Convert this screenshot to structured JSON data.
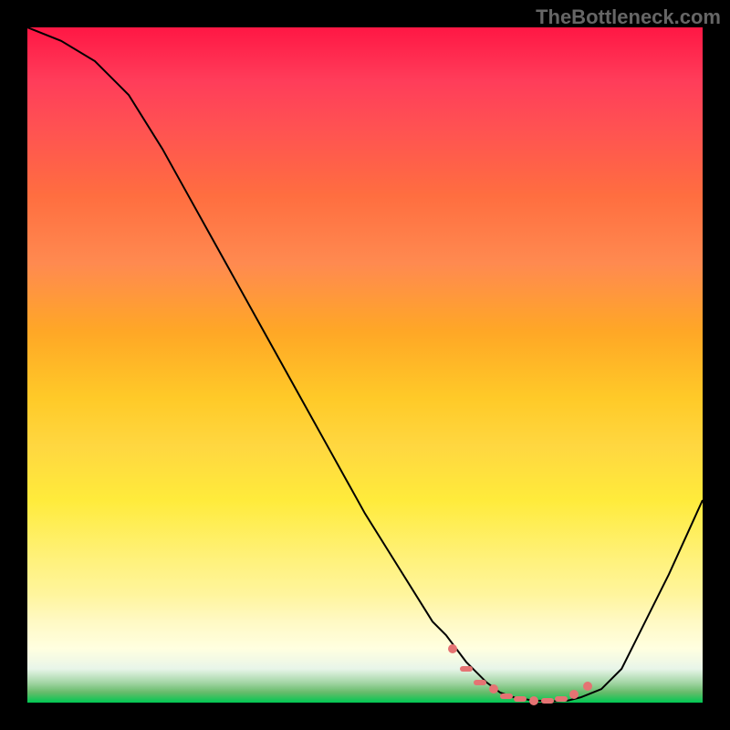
{
  "watermark": "TheBottleneck.com",
  "chart_data": {
    "type": "line",
    "title": "",
    "xlabel": "",
    "ylabel": "",
    "xlim": [
      0,
      100
    ],
    "ylim": [
      0,
      100
    ],
    "curve": {
      "x": [
        0,
        5,
        10,
        15,
        20,
        25,
        30,
        35,
        40,
        45,
        50,
        55,
        60,
        62,
        65,
        68,
        70,
        72,
        75,
        78,
        80,
        82,
        85,
        88,
        90,
        95,
        100
      ],
      "y": [
        100,
        98,
        95,
        90,
        82,
        73,
        64,
        55,
        46,
        37,
        28,
        20,
        12,
        10,
        6,
        3,
        1.5,
        0.8,
        0.3,
        0.2,
        0.3,
        0.8,
        2,
        5,
        9,
        19,
        30
      ]
    },
    "optimal_points": {
      "x": [
        63,
        65,
        67,
        69,
        71,
        73,
        75,
        77,
        79,
        81,
        83
      ],
      "y": [
        8,
        5,
        3,
        2,
        1,
        0.5,
        0.3,
        0.3,
        0.5,
        1.2,
        2.5
      ]
    },
    "background_gradient": {
      "top": "#ff1744",
      "middle": "#ffca28",
      "bottom": "#00c853"
    }
  }
}
